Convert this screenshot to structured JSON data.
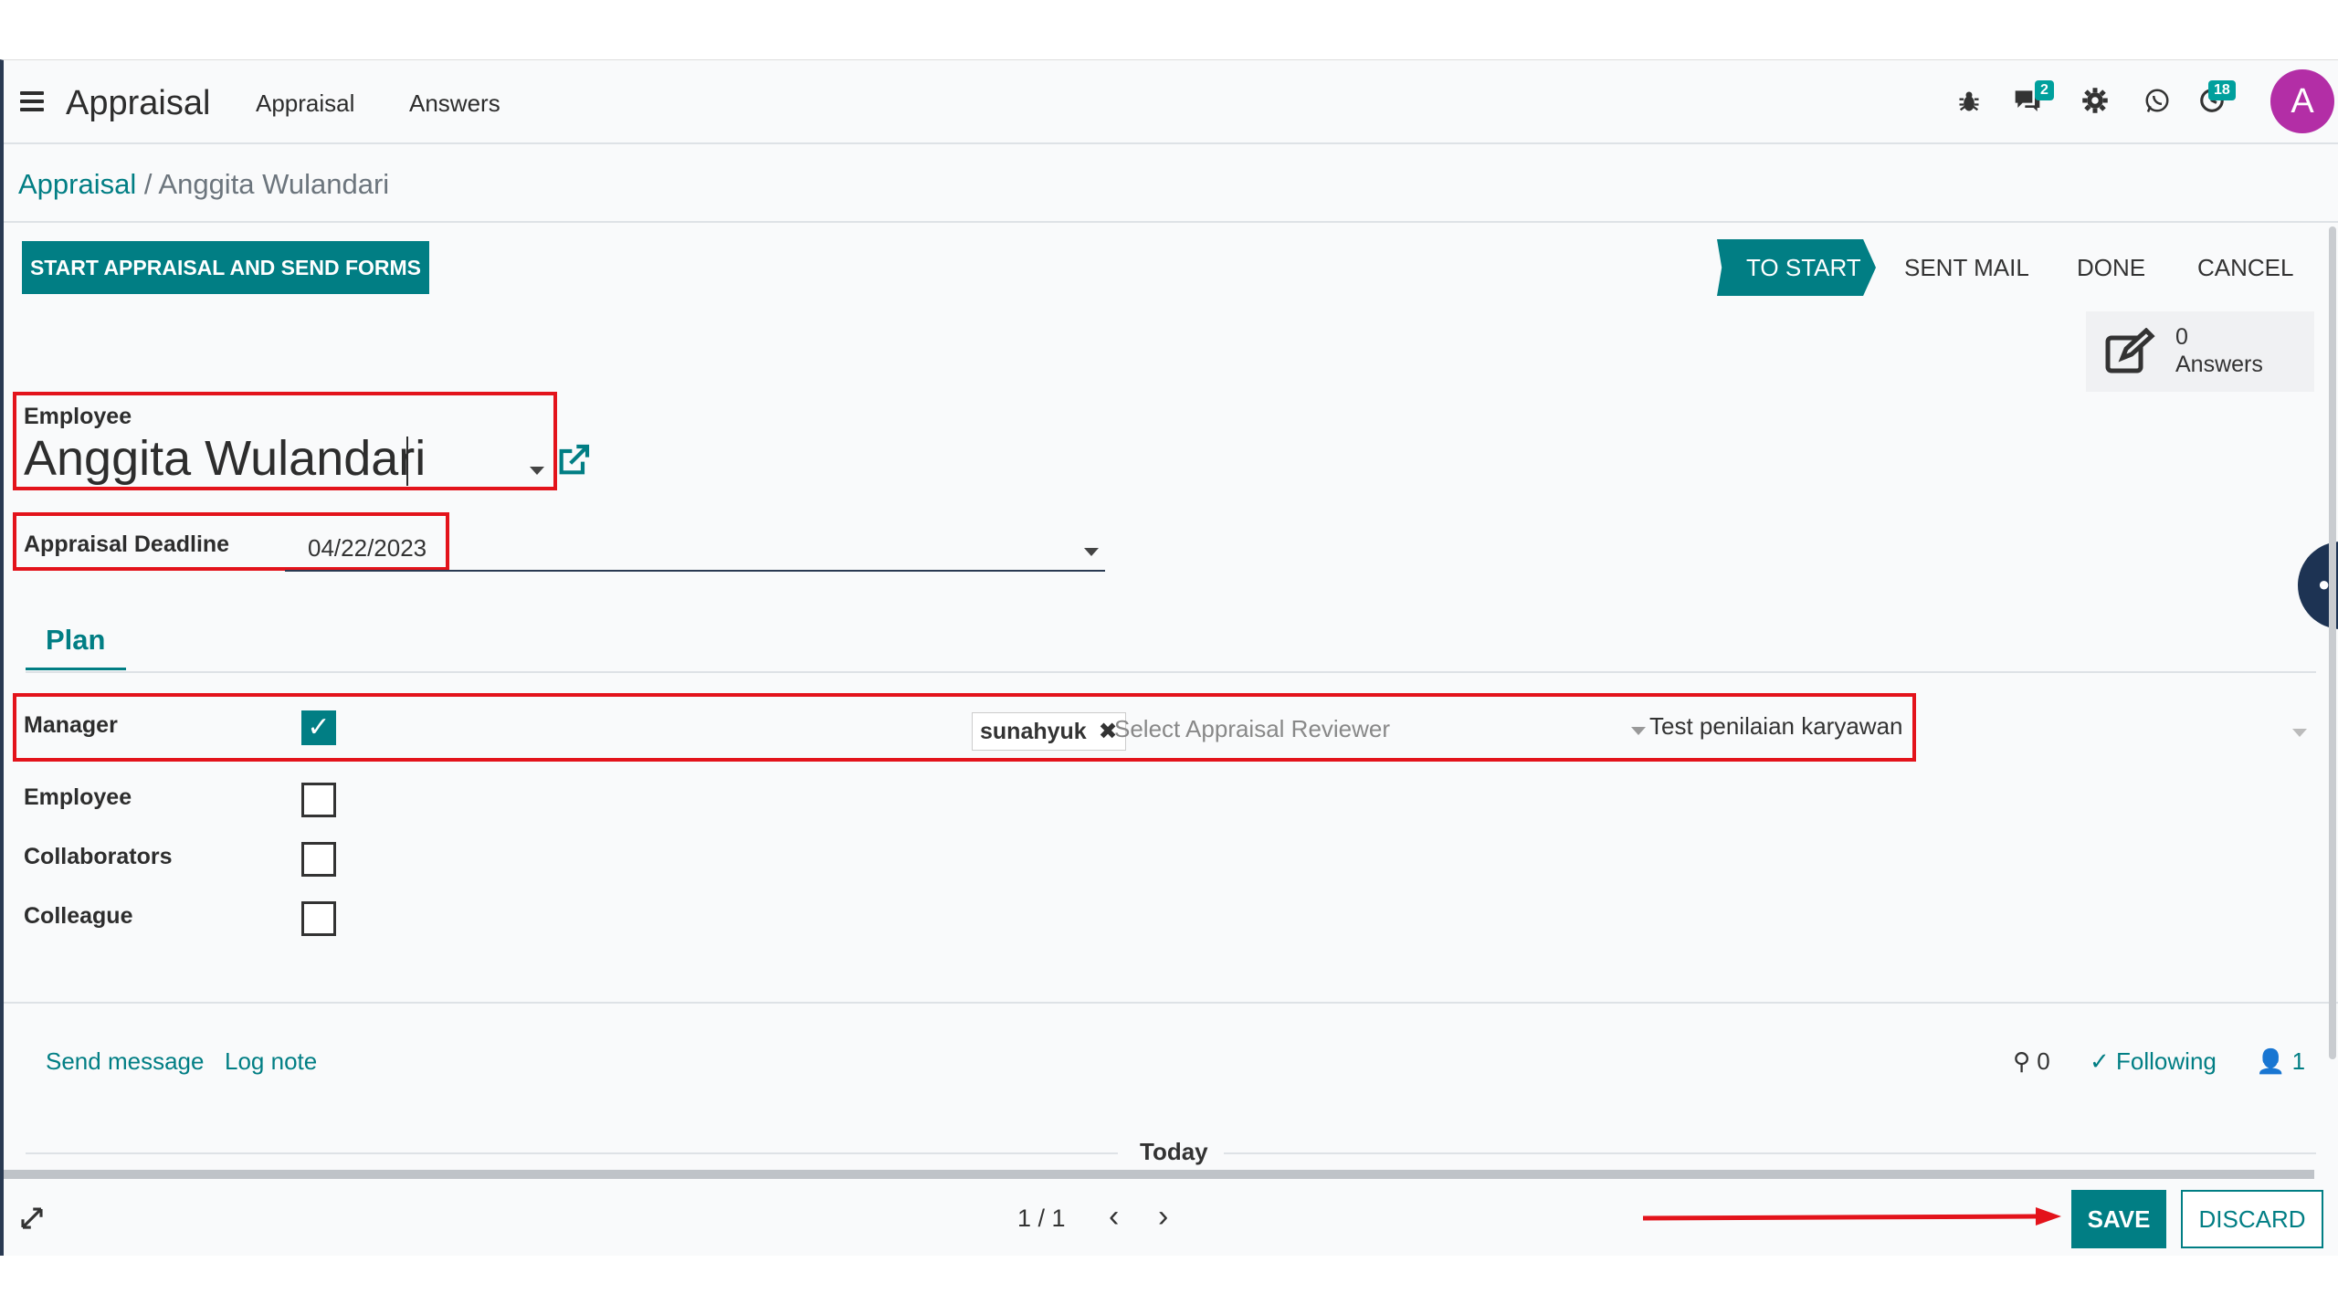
{
  "navbar": {
    "app_title": "Appraisal",
    "menu": [
      "Appraisal",
      "Answers"
    ],
    "icons": [
      "bug-icon",
      "chat-icon",
      "gear-icon",
      "whatsapp-icon",
      "activity-clock-icon"
    ],
    "messages_badge": "2",
    "activities_badge": "18",
    "avatar_letter": "A"
  },
  "breadcrumb": {
    "parent": "Appraisal",
    "separator": "/",
    "current": "Anggita Wulandari"
  },
  "actions": {
    "start_button": "START APPRAISAL AND SEND FORMS",
    "save_button": "SAVE",
    "discard_button": "DISCARD"
  },
  "status_steps": [
    "TO START",
    "SENT MAIL",
    "DONE",
    "CANCEL"
  ],
  "active_status": "TO START",
  "stat": {
    "count": "0",
    "label": "Answers"
  },
  "form": {
    "employee_label": "Employee",
    "employee_value": "Anggita Wulandari",
    "deadline_label": "Appraisal Deadline",
    "deadline_value": "04/22/2023"
  },
  "tabs": [
    "Plan"
  ],
  "plan_rows": [
    {
      "label": "Manager",
      "checked": true,
      "reviewer_tag": "sunahyuk",
      "reviewer_placeholder": "Select Appraisal Reviewer",
      "template": "Test penilaian karyawan"
    },
    {
      "label": "Employee",
      "checked": false
    },
    {
      "label": "Collaborators",
      "checked": false
    },
    {
      "label": "Colleague",
      "checked": false
    }
  ],
  "chatter": {
    "send_message": "Send message",
    "log_note": "Log note",
    "attachments": "0",
    "following": "Following",
    "followers": "1",
    "today": "Today"
  },
  "pager": {
    "text": "1 / 1",
    "prev": "‹",
    "next": "›"
  },
  "colors": {
    "primary": "#017e84",
    "highlight_box": "#e3131b",
    "avatar": "#b32ea6"
  }
}
